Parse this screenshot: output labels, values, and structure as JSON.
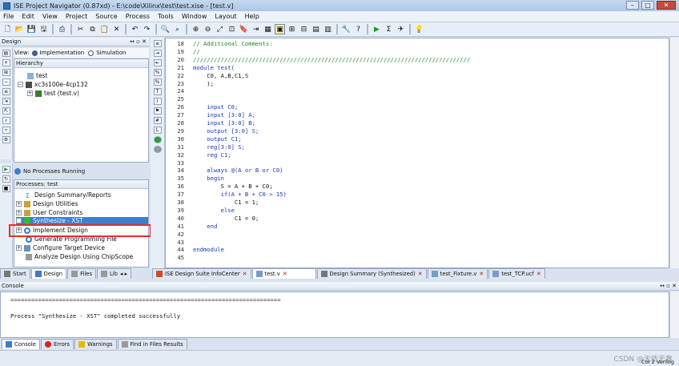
{
  "window": {
    "title": "ISE Project Navigator (0.87xd) - E:\\code\\Xilinx\\test\\test.xise - [test.v]",
    "min": "–",
    "max": "□",
    "close": "✕"
  },
  "menu": [
    "File",
    "Edit",
    "View",
    "Project",
    "Source",
    "Process",
    "Tools",
    "Window",
    "Layout",
    "Help"
  ],
  "design_panel": {
    "title": "Design",
    "view_label": "View:",
    "implementation": "Implementation",
    "simulation": "Simulation",
    "hierarchy_label": "Hierarchy",
    "hierarchy": [
      "test",
      "xc3s100e-4cp132",
      "test (test.v)"
    ],
    "no_processes": "No Processes Running",
    "processes_label": "Processes: test",
    "processes": [
      "Design Summary/Reports",
      "Design Utilities",
      "User Constraints",
      "Synthesize - XST",
      "Implement Design",
      "Generate Programming File",
      "Configure Target Device",
      "Analyze Design Using ChipScope"
    ]
  },
  "left_tabs": [
    "Start",
    "Design",
    "Files",
    "Lib"
  ],
  "code_lines": [
    {
      "n": "18",
      "t": "// Additional Comments:",
      "c": "cm"
    },
    {
      "n": "19",
      "t": "//",
      "c": "cm"
    },
    {
      "n": "20",
      "t": "////////////////////////////////////////////////////////////////////////////////",
      "c": "cm"
    },
    {
      "n": "21",
      "t": "module test(",
      "c": "kw"
    },
    {
      "n": "22",
      "t": "    C0, A,B,C1,S",
      "c": ""
    },
    {
      "n": "23",
      "t": "    );",
      "c": ""
    },
    {
      "n": "24",
      "t": "",
      "c": ""
    },
    {
      "n": "25",
      "t": "",
      "c": ""
    },
    {
      "n": "26",
      "t": "    input C0;",
      "c": "kw"
    },
    {
      "n": "27",
      "t": "    input [3:0] A;",
      "c": "kw"
    },
    {
      "n": "28",
      "t": "    input [3:0] B;",
      "c": "kw"
    },
    {
      "n": "29",
      "t": "    output [3:0] S;",
      "c": "kw"
    },
    {
      "n": "30",
      "t": "    output C1;",
      "c": "kw"
    },
    {
      "n": "31",
      "t": "    reg[3:0] S;",
      "c": "kw"
    },
    {
      "n": "32",
      "t": "    reg C1;",
      "c": "kw"
    },
    {
      "n": "33",
      "t": "",
      "c": ""
    },
    {
      "n": "34",
      "t": "    always @(A or B or C0)",
      "c": "kw"
    },
    {
      "n": "35",
      "t": "    begin",
      "c": "kw"
    },
    {
      "n": "36",
      "t": "        S = A + B + C0;",
      "c": ""
    },
    {
      "n": "37",
      "t": "        if(A + B + C0 > 15)",
      "c": "kw"
    },
    {
      "n": "38",
      "t": "            C1 = 1;",
      "c": ""
    },
    {
      "n": "39",
      "t": "        else",
      "c": "kw"
    },
    {
      "n": "40",
      "t": "            C1 = 0;",
      "c": ""
    },
    {
      "n": "41",
      "t": "    end",
      "c": "kw"
    },
    {
      "n": "42",
      "t": "",
      "c": ""
    },
    {
      "n": "43",
      "t": "",
      "c": ""
    },
    {
      "n": "44",
      "t": "endmodule",
      "c": "kw"
    },
    {
      "n": "45",
      "t": "",
      "c": ""
    }
  ],
  "editor_tabs": [
    "ISE Design Suite InfoCenter",
    "test.v",
    "Design Summary (Synthesized)",
    "test_Fixture.v",
    "test_TCP.ucf"
  ],
  "console": {
    "title": "Console",
    "separator": "==============================================================================",
    "message": "Process \"Synthesize - XST\" completed successfully"
  },
  "console_tabs": [
    "Console",
    "Errors",
    "Warnings",
    "Find in Files Results"
  ],
  "status": {
    "right": "Col 2 Verilog",
    "watermark": "CSDN @无依无靠"
  },
  "colors": {
    "highlight_box": "#e0302a",
    "selected_process": "#3b7fd1"
  }
}
